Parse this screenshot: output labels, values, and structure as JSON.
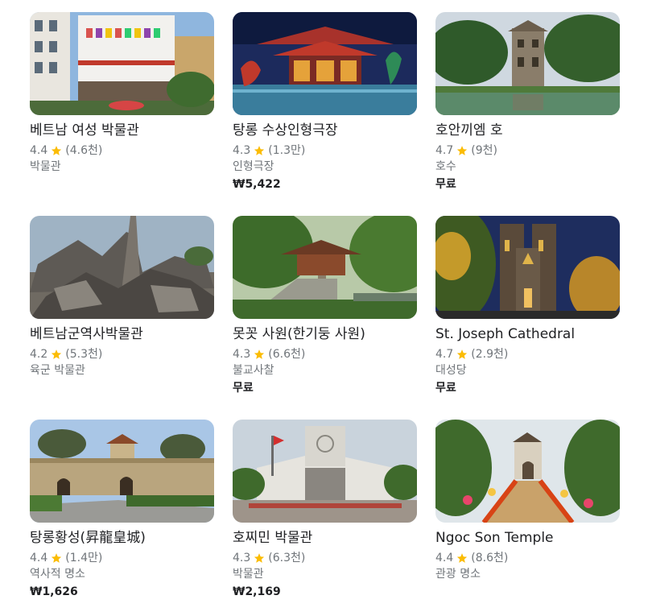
{
  "places": [
    {
      "name": "베트남 여성 박물관",
      "rating": "4.4",
      "reviews": "(4.6천)",
      "category": "박물관",
      "price": ""
    },
    {
      "name": "탕롱 수상인형극장",
      "rating": "4.3",
      "reviews": "(1.3만)",
      "category": "인형극장",
      "price": "₩5,422"
    },
    {
      "name": "호안끼엠 호",
      "rating": "4.7",
      "reviews": "(9천)",
      "category": "호수",
      "price": "무료"
    },
    {
      "name": "베트남군역사박물관",
      "rating": "4.2",
      "reviews": "(5.3천)",
      "category": "육군 박물관",
      "price": ""
    },
    {
      "name": "못꼿 사원(한기둥 사원)",
      "rating": "4.3",
      "reviews": "(6.6천)",
      "category": "불교사찰",
      "price": "무료"
    },
    {
      "name": "St. Joseph Cathedral",
      "rating": "4.7",
      "reviews": "(2.9천)",
      "category": "대성당",
      "price": "무료"
    },
    {
      "name": "탕롱황성(昇龍皇城)",
      "rating": "4.4",
      "reviews": "(1.4만)",
      "category": "역사적 명소",
      "price": "₩1,626"
    },
    {
      "name": "호찌민 박물관",
      "rating": "4.3",
      "reviews": "(6.3천)",
      "category": "박물관",
      "price": "₩2,169"
    },
    {
      "name": "Ngoc Son Temple",
      "rating": "4.4",
      "reviews": "(8.6천)",
      "category": "관광 명소",
      "price": ""
    }
  ],
  "icons": {
    "rating": "star-icon"
  },
  "colors": {
    "star": "#fbbc04",
    "secondary_text": "#70757a",
    "primary_text": "#202124"
  }
}
